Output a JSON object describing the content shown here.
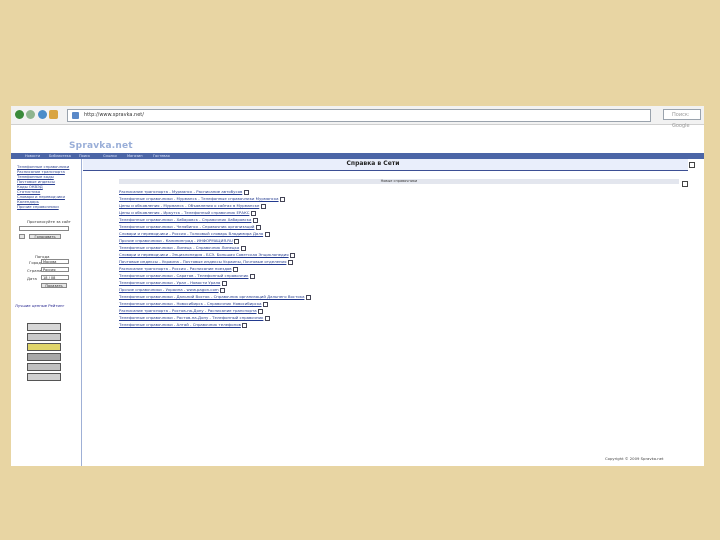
{
  "browser": {
    "url": "http://www.spravka.net/",
    "search_placeholder": "Поиск: Google"
  },
  "site": {
    "logo": "Spravka.net",
    "nav": [
      "Новости",
      "Библиотека",
      "Поиск",
      "Ссылки",
      "Магазин",
      "Гостевая"
    ]
  },
  "sidebar": {
    "links": [
      "Телефонные справочники",
      "Расписание транспорта",
      "Телефонные коды",
      "Почтовые индексы",
      "Коды ОКВЭД",
      "Статистика",
      "Словари и переводчики",
      "Календарь",
      "Прочие справочники"
    ],
    "vote_label": "Проголосуйте за сайт",
    "vote_button": "Голосовать",
    "weather_label": "Погода",
    "city_label": "Город",
    "city_value": "Москва",
    "country_label": "Страна",
    "country_value": "Россия",
    "date_label": "Дата",
    "date_value": "18 / 08",
    "show_button": "Показать",
    "rating_label": "Лучшие ценные Рейтинг"
  },
  "main": {
    "title": "Справка в Сети",
    "section_header": "Новые справочники",
    "entries": [
      "Расписание транспорта - Мурманск - Расписание автобусов",
      "Телефонные справочники - Мурманск - Телефонные справочники Мурманска",
      "Цены и объявления - Мурманск - Объявления о сайтах в Мурманске",
      "Цены и объявления - Иркутск - Телефонный справочник ЕРАКС",
      "Телефонные справочники - Хабаровск - Справочник Хабаровска",
      "Телефонные справочники - Челябинск - Справочник организаций",
      "Словари и переводчики - Россия - Толковый словарь Владимира Даля",
      "Прочие справочники - Калининград - ИНФОРМАЦИЯ.RU",
      "Телефонные справочники - Липецк - Справочник Липецка",
      "Словари и переводчики - Энциклопедия - БСЭ. Большая Советская Энциклопедия",
      "Почтовые индексы - Украина - Почтовые индексы Украины, Почтовые отделения",
      "Расписание транспорта - Россия - Расписание поездов",
      "Телефонные справочники - Саратов - Телефонный справочник",
      "Телефонные справочники - Урал - Новости Урала",
      "Прочие справочники - Украина - www.pagon.com",
      "Телефонные справочники - Дальний Восток - Справочник организаций Дальнего Востока",
      "Телефонные справочники - Новосибирск - Справочник Новосибирска",
      "Расписание транспорта - Ростов-на-Дону - Расписание транспорта",
      "Телефонные справочники - Ростов-на-Дону - Телефонный справочник",
      "Телефонные справочники - Алтай - Справочник телефонов"
    ],
    "footer": "Copyright © 2009 Spravka.net"
  }
}
